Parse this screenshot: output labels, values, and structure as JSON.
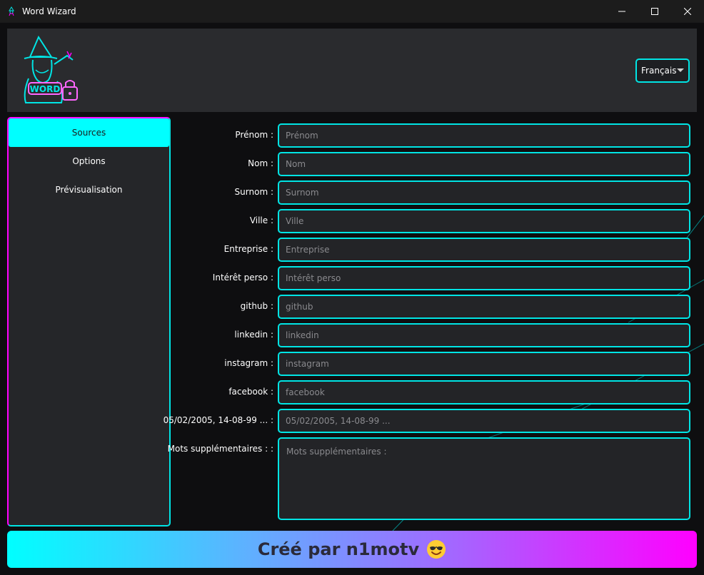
{
  "window": {
    "title": "Word Wizard",
    "icon": "wizard-icon",
    "controls": {
      "minimize": "—",
      "maximize": "□",
      "close": "✕"
    }
  },
  "header": {
    "logo_text": "WORD",
    "language": {
      "selected": "Français"
    }
  },
  "sidebar": {
    "items": [
      {
        "label": "Sources",
        "active": true
      },
      {
        "label": "Options",
        "active": false
      },
      {
        "label": "Prévisualisation",
        "active": false
      }
    ]
  },
  "form": {
    "fields": [
      {
        "label": "Prénom :",
        "placeholder": "Prénom",
        "value": ""
      },
      {
        "label": "Nom :",
        "placeholder": "Nom",
        "value": ""
      },
      {
        "label": "Surnom :",
        "placeholder": "Surnom",
        "value": ""
      },
      {
        "label": "Ville :",
        "placeholder": "Ville",
        "value": ""
      },
      {
        "label": "Entreprise :",
        "placeholder": "Entreprise",
        "value": ""
      },
      {
        "label": "Intérêt perso :",
        "placeholder": "Intérêt perso",
        "value": ""
      },
      {
        "label": "github :",
        "placeholder": "github",
        "value": ""
      },
      {
        "label": "linkedin :",
        "placeholder": "linkedin",
        "value": ""
      },
      {
        "label": "instagram :",
        "placeholder": "instagram",
        "value": ""
      },
      {
        "label": "facebook :",
        "placeholder": "facebook",
        "value": ""
      },
      {
        "label": "05/02/2005, 14-08-99 ... :",
        "placeholder": "05/02/2005, 14-08-99 ...",
        "value": ""
      }
    ],
    "extra": {
      "label": "Mots supplémentaires : :",
      "placeholder": "Mots supplémentaires :",
      "value": ""
    }
  },
  "footer": {
    "text": "Créé par n1motv",
    "emoji": "smiling-face-with-sunglasses-icon"
  },
  "colors": {
    "accent_cyan": "#00e5e5",
    "accent_magenta": "#ff00ff",
    "panel_bg": "#2a2b2e",
    "input_bg": "#232427"
  }
}
